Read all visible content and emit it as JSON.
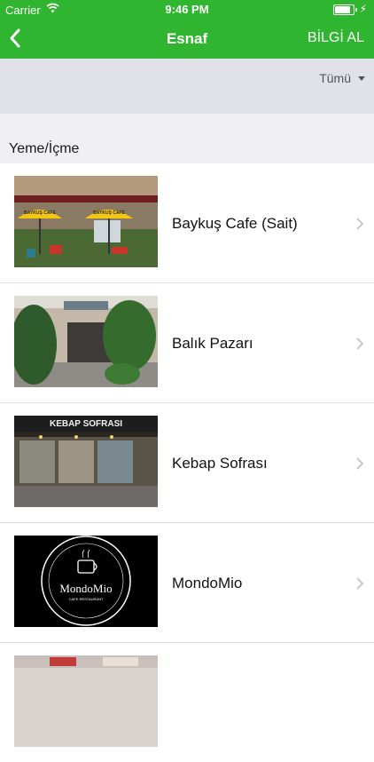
{
  "status_bar": {
    "carrier": "Carrier",
    "time": "9:46 PM",
    "battery_level": 0.95
  },
  "nav": {
    "title": "Esnaf",
    "action": "BİLGİ AL"
  },
  "filter": {
    "label": "Tümü"
  },
  "section": {
    "title": "Yeme/İçme"
  },
  "items": [
    {
      "name": "Baykuş Cafe (Sait)",
      "sign": "BAYKUŞ CAFE"
    },
    {
      "name": "Balık Pazarı"
    },
    {
      "name": "Kebap Sofrası",
      "sign": "KEBAP SOFRASI"
    },
    {
      "name": "MondoMio",
      "logo": "MondoMio",
      "logo_sub": "CAFE·RESTAURANT"
    },
    {
      "name": ""
    }
  ],
  "colors": {
    "header": "#2fb52f",
    "background": "#efeff4",
    "filter_bar": "#e1e1e8",
    "chevron": "#c7c7cc"
  }
}
